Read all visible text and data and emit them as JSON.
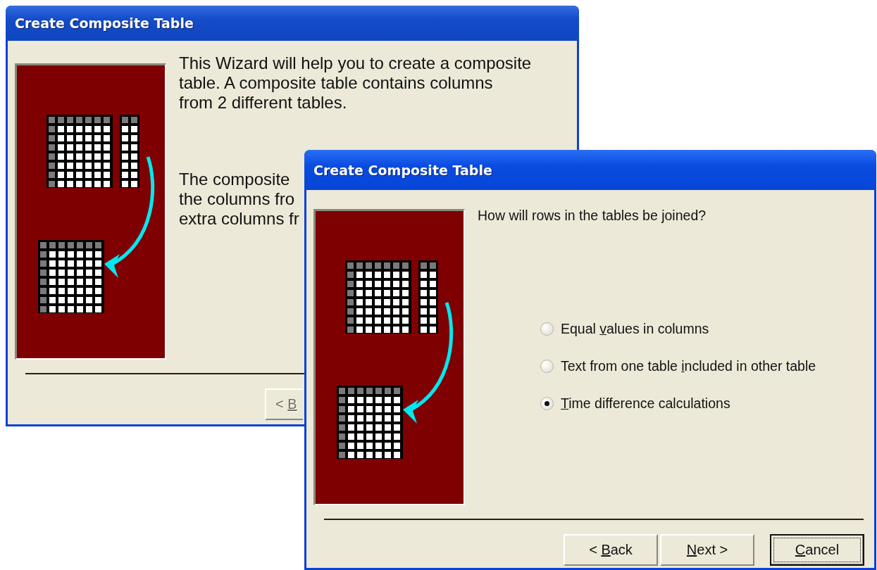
{
  "windows": [
    {
      "title": "Create Composite Table",
      "active": false,
      "intro_lines": [
        "This Wizard will help you to create a composite",
        "table.  A composite table contains columns",
        "from 2 different tables."
      ],
      "detail_lines": [
        "The composite",
        "the columns fro",
        "extra columns fr"
      ],
      "buttons": [
        {
          "before": "< ",
          "key": "B",
          "disabled": true,
          "default": false
        }
      ]
    },
    {
      "title": "Create Composite Table",
      "active": true,
      "question": "How will rows in the tables be joined?",
      "options": [
        {
          "before": "Equal ",
          "key": "v",
          "after": "alues in columns",
          "selected": false
        },
        {
          "before": "Text from one table ",
          "key": "i",
          "after": "ncluded in other table",
          "selected": false
        },
        {
          "key": "T",
          "after": "ime difference calculations",
          "selected": true
        }
      ],
      "buttons": [
        {
          "before": "< ",
          "key": "B",
          "after": "ack",
          "disabled": false,
          "default": false
        },
        {
          "key": "N",
          "after": "ext >",
          "disabled": false,
          "default": false
        },
        {
          "key": "C",
          "after": "ancel",
          "disabled": false,
          "default": true
        }
      ]
    }
  ]
}
